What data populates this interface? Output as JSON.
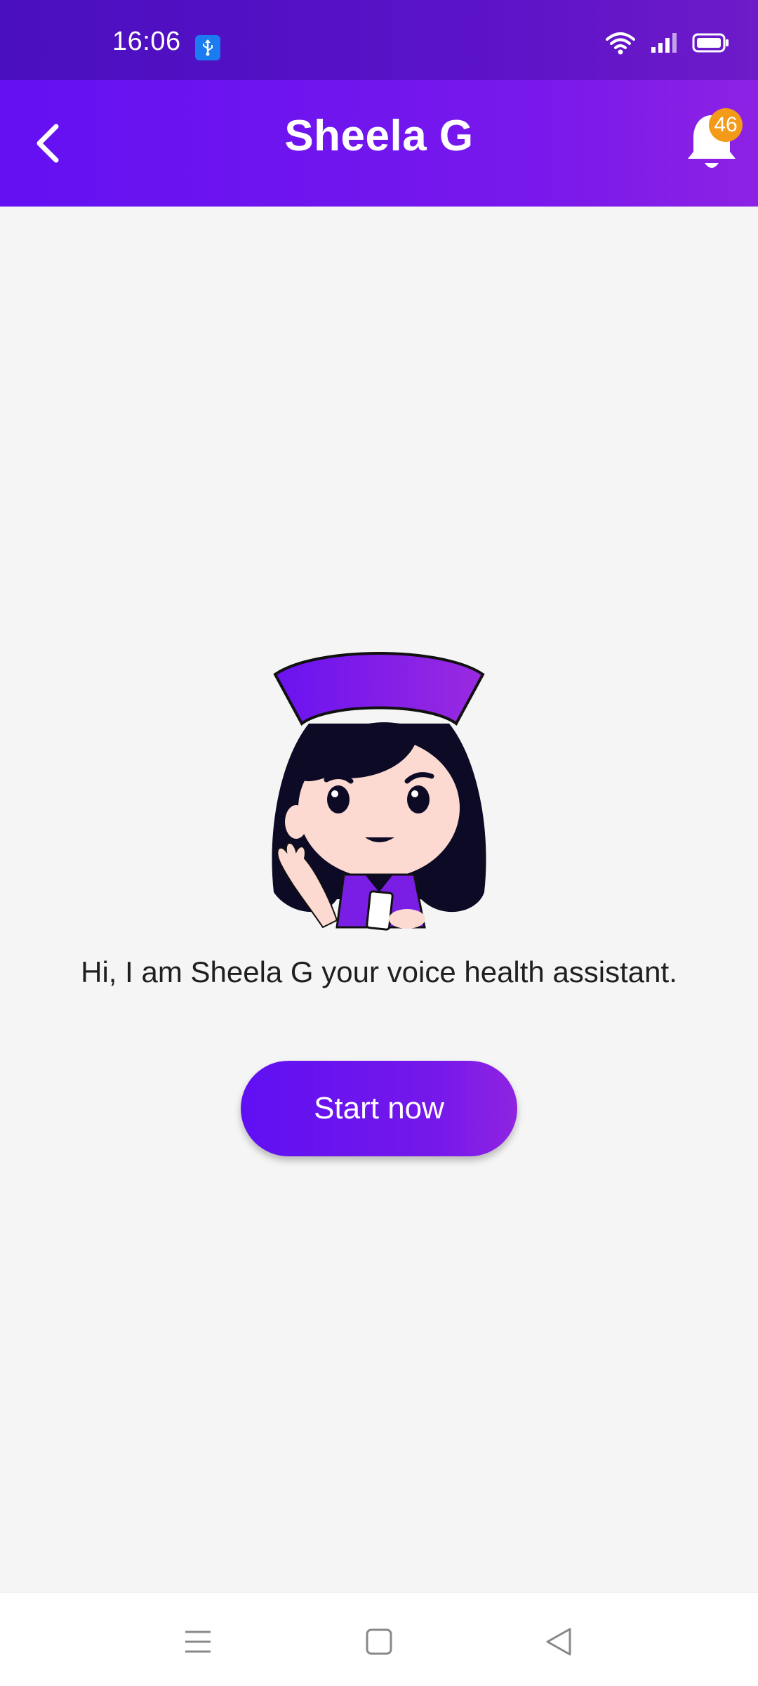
{
  "status_bar": {
    "time": "16:06"
  },
  "header": {
    "title": "Sheela G",
    "notification_count": "46"
  },
  "main": {
    "greeting": "Hi, I am Sheela G your voice health assistant.",
    "start_button_label": "Start now"
  },
  "icons": {
    "back": "back-arrow-icon",
    "bell": "bell-icon",
    "usb": "usb-icon",
    "wifi": "wifi-icon",
    "signal": "signal-icon",
    "battery": "battery-icon",
    "nav_menu": "menu-icon",
    "nav_home": "home-square-icon",
    "nav_back": "back-triangle-icon"
  },
  "colors": {
    "header_gradient_start": "#6310f2",
    "header_gradient_end": "#8d22e4",
    "badge": "#f39b18",
    "button_gradient_start": "#5f10f3",
    "button_gradient_end": "#8f24e2",
    "background": "#f5f5f5"
  }
}
